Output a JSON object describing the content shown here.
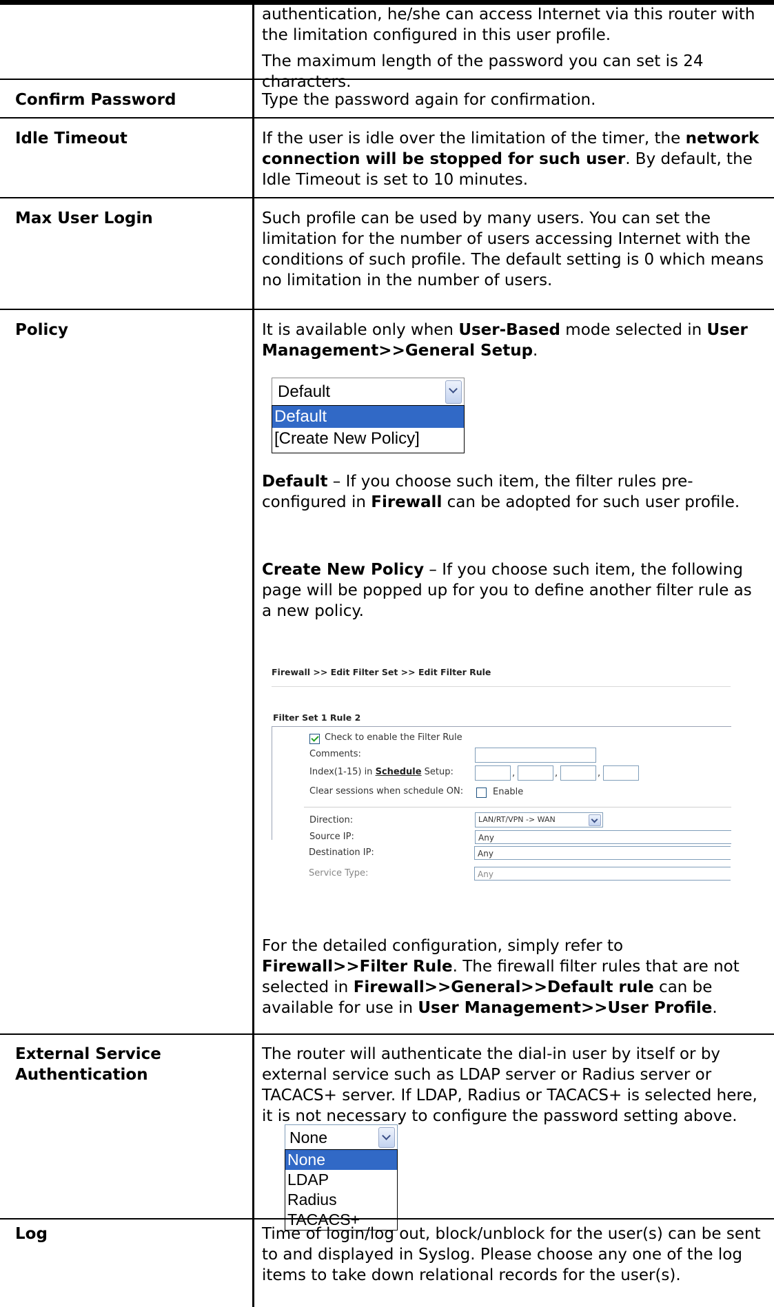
{
  "rows": [
    {
      "label": "",
      "paragraphs": [
        "authentication, he/she can access Internet via this router with the limitation configured in this user profile.",
        "The maximum length of the password you can set is 24 characters."
      ]
    },
    {
      "label": "Confirm Password",
      "text": "Type the password again for confirmation."
    },
    {
      "label": "Idle Timeout",
      "text_a": "If the user is idle over the limitation of the timer, the ",
      "text_b": "network connection will be stopped for such user",
      "text_c": ". By default, the Idle Timeout is set to 10 minutes."
    },
    {
      "label": "Max User Login",
      "text": "Such profile can be used by many users. You can set the limitation for the number of users accessing Internet with the conditions of such profile. The default setting is 0 which means no limitation in the number of users."
    },
    {
      "label": "Policy",
      "intro_a": "It is available only when ",
      "intro_b": "User-Based",
      "intro_c": " mode selected in ",
      "intro_d": "User Management>>General Setup",
      "intro_e": ".",
      "select_value": "Default",
      "options": [
        "Default",
        "[Create New Policy]"
      ],
      "default_term": "Default",
      "default_a": " – If you choose such item, the filter rules pre-configured in ",
      "default_b": "Firewall",
      "default_c": " can be adopted for such user profile.",
      "create_term": "Create New Policy",
      "create_text": " – If you choose such item, the following page will be popped up for you to define another filter rule as a new policy.",
      "firewall": {
        "breadcrumb": "Firewall >> Edit Filter Set >> Edit Filter Rule",
        "set_title": "Filter Set 1 Rule 2",
        "enable_label": "Check to enable the Filter Rule",
        "comments_label": "Comments:",
        "index_label_a": "Index(1-15) in ",
        "index_label_link": "Schedule",
        "index_label_b": " Setup:",
        "clear_label": "Clear sessions when schedule ON:",
        "clear_enable": "Enable",
        "direction_label": "Direction:",
        "direction_value": "LAN/RT/VPN -> WAN",
        "source_label": "Source IP:",
        "source_value": "Any",
        "dest_label": "Destination IP:",
        "dest_value": "Any",
        "service_label": "Service Type:",
        "service_value": "Any"
      },
      "detail_a": "For the detailed configuration, simply refer to ",
      "detail_b": "Firewall>>Filter Rule",
      "detail_c": ". The firewall filter rules that are not selected in ",
      "detail_d": "Firewall>>General>>Default rule",
      "detail_e": " can be available for use in ",
      "detail_f": "User Management>>User Profile",
      "detail_g": "."
    },
    {
      "label_line1": "External Service",
      "label_line2": "Authentication",
      "text": "The router will authenticate the dial-in user by itself or by external service such as LDAP server or Radius server or TACACS+ server. If LDAP, Radius or TACACS+ is selected here, it is not necessary to configure the password setting above.",
      "select_value": "None",
      "options": [
        "None",
        "LDAP",
        "Radius",
        "TACACS+"
      ]
    },
    {
      "label": "Log",
      "text": "Time of login/log out, block/unblock for the user(s) can be sent to and displayed in Syslog. Please choose any one of the log items to take down relational records for the user(s)."
    }
  ]
}
